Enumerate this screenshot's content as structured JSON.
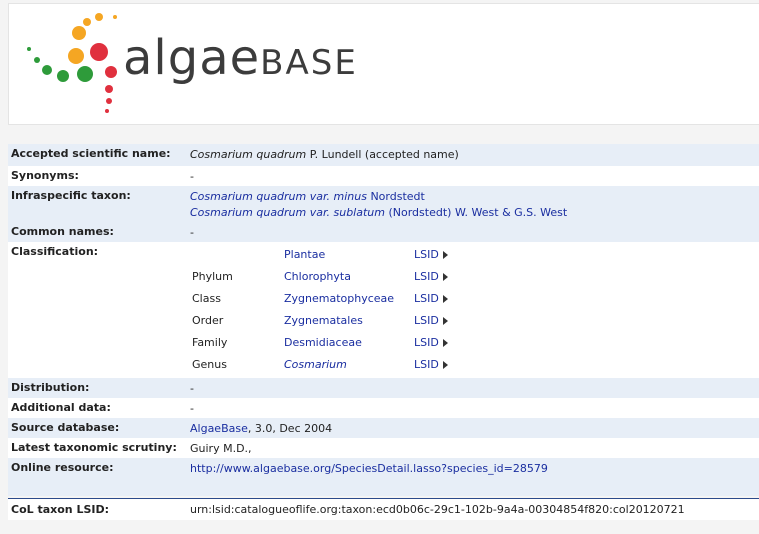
{
  "logo": {
    "big": "algae",
    "small": "BASE"
  },
  "rows": {
    "accepted": {
      "label": "Accepted scientific name:",
      "name_italic": "Cosmarium quadrum",
      "rest": " P. Lundell (accepted name)"
    },
    "synonyms": {
      "label": "Synonyms:",
      "value": "-"
    },
    "infraspecific": {
      "label": "Infraspecific taxon:",
      "items": [
        {
          "italic": "Cosmarium quadrum var. minus",
          "author": " Nordstedt"
        },
        {
          "italic": "Cosmarium quadrum var. sublatum",
          "author": " (Nordstedt) W. West & G.S. West"
        }
      ]
    },
    "common": {
      "label": "Common names:",
      "value": "-"
    },
    "classification": {
      "label": "Classification:",
      "items": [
        {
          "rank": "",
          "name": "Plantae",
          "lsid": "LSID"
        },
        {
          "rank": "Phylum",
          "name": "Chlorophyta",
          "lsid": "LSID"
        },
        {
          "rank": "Class",
          "name": "Zygnematophyceae",
          "lsid": "LSID"
        },
        {
          "rank": "Order",
          "name": "Zygnematales",
          "lsid": "LSID"
        },
        {
          "rank": "Family",
          "name": "Desmidiaceae",
          "lsid": "LSID"
        },
        {
          "rank": "Genus",
          "name": "Cosmarium",
          "lsid": "LSID"
        }
      ]
    },
    "distribution": {
      "label": "Distribution:",
      "value": "-"
    },
    "additional": {
      "label": "Additional data:",
      "value": "-"
    },
    "source": {
      "label": "Source database:",
      "link": "AlgaeBase",
      "rest": ", 3.0, Dec 2004"
    },
    "scrutiny": {
      "label": "Latest taxonomic scrutiny:",
      "value": "Guiry M.D.,"
    },
    "online": {
      "label": "Online resource:",
      "link": "http://www.algaebase.org/SpeciesDetail.lasso?species_id=28579"
    }
  },
  "col": {
    "label": "CoL taxon LSID:",
    "value": "urn:lsid:catalogueoflife.org:taxon:ecd0b06c-29c1-102b-9a4a-00304854f820:col20120721"
  },
  "colors": {
    "row_alt": "#e7eef7",
    "link": "#1a2ea0",
    "divider": "#2b4a8b"
  }
}
